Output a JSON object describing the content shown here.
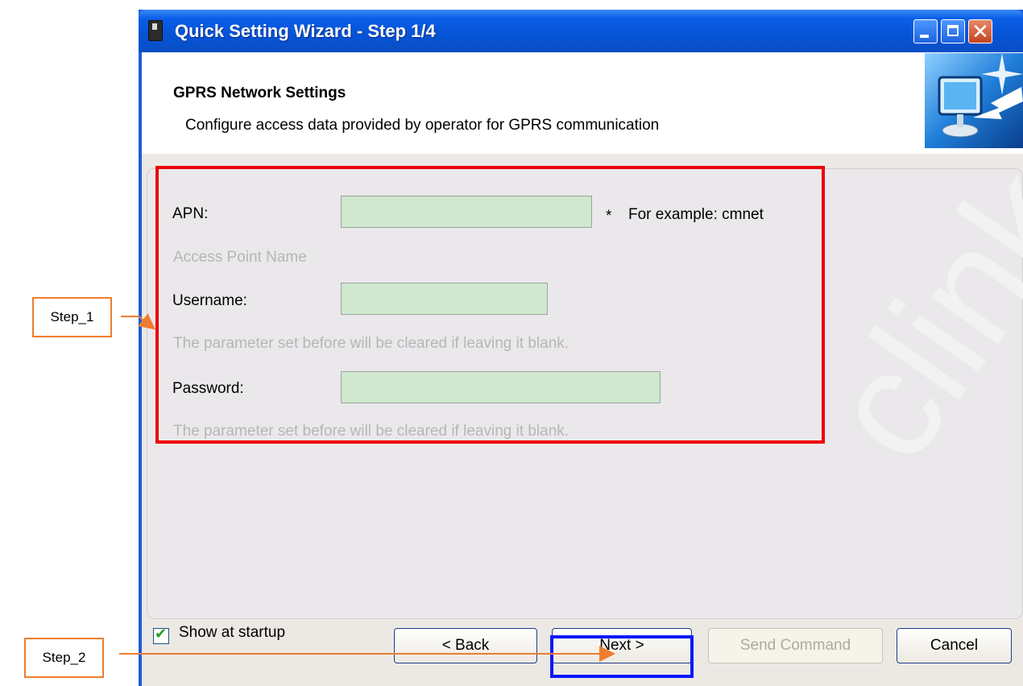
{
  "window": {
    "title": "Quick Setting Wizard - Step 1/4",
    "minimize_label": "_",
    "maximize_label": "□",
    "close_label": "✕"
  },
  "header": {
    "title": "GPRS Network Settings",
    "subtitle": "Configure access data provided by operator for GPRS communication",
    "icon": "monitor-arrow-icon"
  },
  "form": {
    "apn": {
      "label": "APN:",
      "value": "",
      "required_mark": "*",
      "example": "For example: cmnet",
      "hint": "Access Point Name"
    },
    "username": {
      "label": "Username:",
      "value": "",
      "hint": "The parameter set before will be cleared if leaving it blank."
    },
    "password": {
      "label": "Password:",
      "value": "",
      "hint": "The parameter set before will be cleared if leaving it blank."
    }
  },
  "footer": {
    "show_at_startup_label": "Show at startup",
    "show_at_startup_checked": true,
    "back_label": "< Back",
    "next_label": "Next >",
    "send_command_label": "Send Command",
    "cancel_label": "Cancel"
  },
  "watermark": "clink",
  "annotations": {
    "step1": "Step_1",
    "step2": "Step_2",
    "step1_box_color": "#ee0000",
    "step2_box_color": "#0a18ff",
    "callout_color": "#ed7d31"
  }
}
